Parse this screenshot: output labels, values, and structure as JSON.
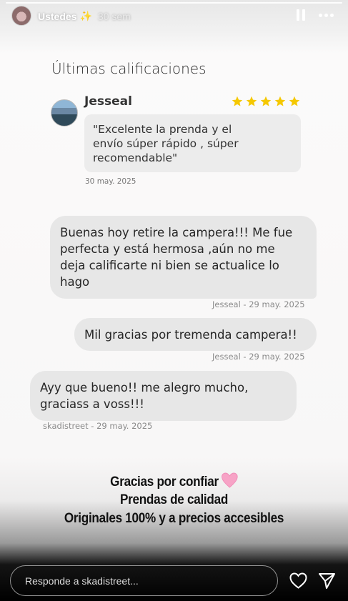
{
  "header": {
    "username": "Ustedes",
    "sparkle": "✨",
    "time": "30 sem"
  },
  "rating": {
    "title": "Últimas calificaciones",
    "reviewer": "Jesseal",
    "stars": 5,
    "star_color": "#f5c800",
    "review_text": "\"Excelente la prenda y el\nenvío súper rápido , súper\nrecomendable\"",
    "date": "30 may. 2025"
  },
  "chat": [
    {
      "text": "Buenas hoy retire la campera!!! Me fue\nperfecta y está hermosa ,aún no me\ndeja calificarte ni bien se actualice lo\nhago",
      "meta": "Jesseal - 29 may. 2025"
    },
    {
      "text": "Mil gracias por tremenda campera!!",
      "meta": "Jesseal - 29 may. 2025"
    },
    {
      "text": "Ayy que bueno!! me alegro mucho,\ngraciass a voss!!!",
      "meta": "skadistreet - 29 may. 2025"
    }
  ],
  "caption": {
    "line1": "Gracias por confiar",
    "line2": "Prendas de calidad",
    "line3": "Originales 100% y a precios accesibles"
  },
  "footer": {
    "reply_placeholder": "Responde a skadistreet..."
  },
  "icons": {
    "pause": "pause-icon",
    "more": "more-icon",
    "like": "heart-icon",
    "send": "send-icon"
  }
}
